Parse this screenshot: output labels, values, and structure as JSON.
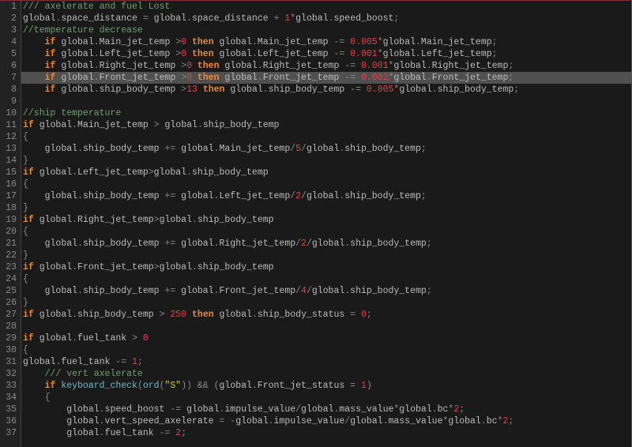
{
  "highlighted_line": 7,
  "lines": [
    {
      "n": 1,
      "tokens": [
        [
          "c",
          "/// axelerate and fuel Lost"
        ]
      ]
    },
    {
      "n": 2,
      "tokens": [
        [
          "v",
          "global"
        ],
        [
          "o",
          "."
        ],
        [
          "v",
          "space_distance"
        ],
        [
          "o",
          " = "
        ],
        [
          "v",
          "global"
        ],
        [
          "o",
          "."
        ],
        [
          "v",
          "space_distance"
        ],
        [
          "o",
          " + "
        ],
        [
          "n",
          "1"
        ],
        [
          "o",
          "*"
        ],
        [
          "v",
          "global"
        ],
        [
          "o",
          "."
        ],
        [
          "v",
          "speed_boost"
        ],
        [
          "o",
          ";"
        ]
      ]
    },
    {
      "n": 3,
      "tokens": [
        [
          "c",
          "//temperature decrease"
        ]
      ]
    },
    {
      "n": 4,
      "tokens": [
        [
          "o",
          "    "
        ],
        [
          "kw",
          "if"
        ],
        [
          "o",
          " "
        ],
        [
          "v",
          "global"
        ],
        [
          "o",
          "."
        ],
        [
          "v",
          "Main_jet_temp"
        ],
        [
          "o",
          " >"
        ],
        [
          "n",
          "0"
        ],
        [
          "o",
          " "
        ],
        [
          "kw",
          "then"
        ],
        [
          "o",
          " "
        ],
        [
          "v",
          "global"
        ],
        [
          "o",
          "."
        ],
        [
          "v",
          "Main_jet_temp"
        ],
        [
          "o",
          " -= "
        ],
        [
          "n",
          "0.005"
        ],
        [
          "o",
          "*"
        ],
        [
          "v",
          "global"
        ],
        [
          "o",
          "."
        ],
        [
          "v",
          "Main_jet_temp"
        ],
        [
          "o",
          ";"
        ]
      ]
    },
    {
      "n": 5,
      "tokens": [
        [
          "o",
          "    "
        ],
        [
          "kw",
          "if"
        ],
        [
          "o",
          " "
        ],
        [
          "v",
          "global"
        ],
        [
          "o",
          "."
        ],
        [
          "v",
          "Left_jet_temp"
        ],
        [
          "o",
          " >"
        ],
        [
          "n",
          "0"
        ],
        [
          "o",
          " "
        ],
        [
          "kw",
          "then"
        ],
        [
          "o",
          " "
        ],
        [
          "v",
          "global"
        ],
        [
          "o",
          "."
        ],
        [
          "v",
          "Left_jet_temp"
        ],
        [
          "o",
          " -= "
        ],
        [
          "n",
          "0.001"
        ],
        [
          "o",
          "*"
        ],
        [
          "v",
          "global"
        ],
        [
          "o",
          "."
        ],
        [
          "v",
          "Left_jet_temp"
        ],
        [
          "o",
          ";"
        ]
      ]
    },
    {
      "n": 6,
      "tokens": [
        [
          "o",
          "    "
        ],
        [
          "kw",
          "if"
        ],
        [
          "o",
          " "
        ],
        [
          "v",
          "global"
        ],
        [
          "o",
          "."
        ],
        [
          "v",
          "Right_jet_temp"
        ],
        [
          "o",
          " >"
        ],
        [
          "n",
          "0"
        ],
        [
          "o",
          " "
        ],
        [
          "kw",
          "then"
        ],
        [
          "o",
          " "
        ],
        [
          "v",
          "global"
        ],
        [
          "o",
          "."
        ],
        [
          "v",
          "Right_jet_temp"
        ],
        [
          "o",
          " -= "
        ],
        [
          "n",
          "0.001"
        ],
        [
          "o",
          "*"
        ],
        [
          "v",
          "global"
        ],
        [
          "o",
          "."
        ],
        [
          "v",
          "Right_jet_temp"
        ],
        [
          "o",
          ";"
        ]
      ]
    },
    {
      "n": 7,
      "tokens": [
        [
          "o",
          "    "
        ],
        [
          "kw",
          "if"
        ],
        [
          "o",
          " "
        ],
        [
          "v",
          "global"
        ],
        [
          "o",
          "."
        ],
        [
          "v",
          "Front_jet_temp"
        ],
        [
          "o",
          " >"
        ],
        [
          "n",
          "0"
        ],
        [
          "o",
          " "
        ],
        [
          "kw",
          "then"
        ],
        [
          "o",
          " "
        ],
        [
          "v",
          "global"
        ],
        [
          "o",
          "."
        ],
        [
          "v",
          "Front_jet_temp"
        ],
        [
          "o",
          " -= "
        ],
        [
          "n",
          "0.002"
        ],
        [
          "o",
          "*"
        ],
        [
          "v",
          "global"
        ],
        [
          "o",
          "."
        ],
        [
          "v",
          "Front_jet_temp"
        ],
        [
          "o",
          ";"
        ]
      ]
    },
    {
      "n": 8,
      "tokens": [
        [
          "o",
          "    "
        ],
        [
          "kw",
          "if"
        ],
        [
          "o",
          " "
        ],
        [
          "v",
          "global"
        ],
        [
          "o",
          "."
        ],
        [
          "v",
          "ship_body_temp"
        ],
        [
          "o",
          " >"
        ],
        [
          "n",
          "13"
        ],
        [
          "o",
          " "
        ],
        [
          "kw",
          "then"
        ],
        [
          "o",
          " "
        ],
        [
          "v",
          "global"
        ],
        [
          "o",
          "."
        ],
        [
          "v",
          "ship_body_temp"
        ],
        [
          "o",
          " -= "
        ],
        [
          "n",
          "0.005"
        ],
        [
          "o",
          "*"
        ],
        [
          "v",
          "global"
        ],
        [
          "o",
          "."
        ],
        [
          "v",
          "ship_body_temp"
        ],
        [
          "o",
          ";"
        ]
      ]
    },
    {
      "n": 9,
      "tokens": []
    },
    {
      "n": 10,
      "tokens": [
        [
          "c",
          "//ship temperature"
        ]
      ]
    },
    {
      "n": 11,
      "tokens": [
        [
          "kw",
          "if"
        ],
        [
          "o",
          " "
        ],
        [
          "v",
          "global"
        ],
        [
          "o",
          "."
        ],
        [
          "v",
          "Main_jet_temp"
        ],
        [
          "o",
          " > "
        ],
        [
          "v",
          "global"
        ],
        [
          "o",
          "."
        ],
        [
          "v",
          "ship_body_temp"
        ]
      ]
    },
    {
      "n": 12,
      "tokens": [
        [
          "b",
          "{"
        ]
      ]
    },
    {
      "n": 13,
      "tokens": [
        [
          "o",
          "    "
        ],
        [
          "v",
          "global"
        ],
        [
          "o",
          "."
        ],
        [
          "v",
          "ship_body_temp"
        ],
        [
          "o",
          " += "
        ],
        [
          "v",
          "global"
        ],
        [
          "o",
          "."
        ],
        [
          "v",
          "Main_jet_temp"
        ],
        [
          "o",
          "/"
        ],
        [
          "n",
          "5"
        ],
        [
          "o",
          "/"
        ],
        [
          "v",
          "global"
        ],
        [
          "o",
          "."
        ],
        [
          "v",
          "ship_body_temp"
        ],
        [
          "o",
          ";"
        ]
      ]
    },
    {
      "n": 14,
      "tokens": [
        [
          "b",
          "}"
        ]
      ]
    },
    {
      "n": 15,
      "tokens": [
        [
          "kw",
          "if"
        ],
        [
          "o",
          " "
        ],
        [
          "v",
          "global"
        ],
        [
          "o",
          "."
        ],
        [
          "v",
          "Left_jet_temp"
        ],
        [
          "o",
          ">"
        ],
        [
          "v",
          "global"
        ],
        [
          "o",
          "."
        ],
        [
          "v",
          "ship_body_temp"
        ]
      ]
    },
    {
      "n": 16,
      "tokens": [
        [
          "b",
          "{"
        ]
      ]
    },
    {
      "n": 17,
      "tokens": [
        [
          "o",
          "    "
        ],
        [
          "v",
          "global"
        ],
        [
          "o",
          "."
        ],
        [
          "v",
          "ship_body_temp"
        ],
        [
          "o",
          " += "
        ],
        [
          "v",
          "global"
        ],
        [
          "o",
          "."
        ],
        [
          "v",
          "Left_jet_temp"
        ],
        [
          "o",
          "/"
        ],
        [
          "n",
          "2"
        ],
        [
          "o",
          "/"
        ],
        [
          "v",
          "global"
        ],
        [
          "o",
          "."
        ],
        [
          "v",
          "ship_body_temp"
        ],
        [
          "o",
          ";"
        ]
      ]
    },
    {
      "n": 18,
      "tokens": [
        [
          "b",
          "}"
        ]
      ]
    },
    {
      "n": 19,
      "tokens": [
        [
          "kw",
          "if"
        ],
        [
          "o",
          " "
        ],
        [
          "v",
          "global"
        ],
        [
          "o",
          "."
        ],
        [
          "v",
          "Right_jet_temp"
        ],
        [
          "o",
          ">"
        ],
        [
          "v",
          "global"
        ],
        [
          "o",
          "."
        ],
        [
          "v",
          "ship_body_temp"
        ]
      ]
    },
    {
      "n": 20,
      "tokens": [
        [
          "b",
          "{"
        ]
      ]
    },
    {
      "n": 21,
      "tokens": [
        [
          "o",
          "    "
        ],
        [
          "v",
          "global"
        ],
        [
          "o",
          "."
        ],
        [
          "v",
          "ship_body_temp"
        ],
        [
          "o",
          " += "
        ],
        [
          "v",
          "global"
        ],
        [
          "o",
          "."
        ],
        [
          "v",
          "Right_jet_temp"
        ],
        [
          "o",
          "/"
        ],
        [
          "n",
          "2"
        ],
        [
          "o",
          "/"
        ],
        [
          "v",
          "global"
        ],
        [
          "o",
          "."
        ],
        [
          "v",
          "ship_body_temp"
        ],
        [
          "o",
          ";"
        ]
      ]
    },
    {
      "n": 22,
      "tokens": [
        [
          "b",
          "}"
        ]
      ]
    },
    {
      "n": 23,
      "tokens": [
        [
          "kw",
          "if"
        ],
        [
          "o",
          " "
        ],
        [
          "v",
          "global"
        ],
        [
          "o",
          "."
        ],
        [
          "v",
          "Front_jet_temp"
        ],
        [
          "o",
          ">"
        ],
        [
          "v",
          "global"
        ],
        [
          "o",
          "."
        ],
        [
          "v",
          "ship_body_temp"
        ]
      ]
    },
    {
      "n": 24,
      "tokens": [
        [
          "b",
          "{"
        ]
      ]
    },
    {
      "n": 25,
      "tokens": [
        [
          "o",
          "    "
        ],
        [
          "v",
          "global"
        ],
        [
          "o",
          "."
        ],
        [
          "v",
          "ship_body_temp"
        ],
        [
          "o",
          " += "
        ],
        [
          "v",
          "global"
        ],
        [
          "o",
          "."
        ],
        [
          "v",
          "Front_jet_temp"
        ],
        [
          "o",
          "/"
        ],
        [
          "n",
          "4"
        ],
        [
          "o",
          "/"
        ],
        [
          "v",
          "global"
        ],
        [
          "o",
          "."
        ],
        [
          "v",
          "ship_body_temp"
        ],
        [
          "o",
          ";"
        ]
      ]
    },
    {
      "n": 26,
      "tokens": [
        [
          "b",
          "}"
        ]
      ]
    },
    {
      "n": 27,
      "tokens": [
        [
          "kw",
          "if"
        ],
        [
          "o",
          " "
        ],
        [
          "v",
          "global"
        ],
        [
          "o",
          "."
        ],
        [
          "v",
          "ship_body_temp"
        ],
        [
          "o",
          " > "
        ],
        [
          "n",
          "250"
        ],
        [
          "o",
          " "
        ],
        [
          "kw",
          "then"
        ],
        [
          "o",
          " "
        ],
        [
          "v",
          "global"
        ],
        [
          "o",
          "."
        ],
        [
          "v",
          "ship_body_status"
        ],
        [
          "o",
          " = "
        ],
        [
          "n",
          "0"
        ],
        [
          "o",
          ";"
        ]
      ]
    },
    {
      "n": 28,
      "tokens": []
    },
    {
      "n": 29,
      "tokens": [
        [
          "kw",
          "if"
        ],
        [
          "o",
          " "
        ],
        [
          "v",
          "global"
        ],
        [
          "o",
          "."
        ],
        [
          "v",
          "fuel_tank"
        ],
        [
          "o",
          " > "
        ],
        [
          "n",
          "0"
        ]
      ]
    },
    {
      "n": 30,
      "tokens": [
        [
          "b",
          "{"
        ]
      ]
    },
    {
      "n": 31,
      "tokens": [
        [
          "v",
          "global"
        ],
        [
          "o",
          "."
        ],
        [
          "v",
          "fuel_tank"
        ],
        [
          "o",
          " -= "
        ],
        [
          "n",
          "1"
        ],
        [
          "o",
          ";"
        ]
      ]
    },
    {
      "n": 32,
      "tokens": [
        [
          "o",
          "    "
        ],
        [
          "c",
          "/// vert axelerate"
        ]
      ]
    },
    {
      "n": 33,
      "tokens": [
        [
          "o",
          "    "
        ],
        [
          "kw",
          "if"
        ],
        [
          "o",
          " "
        ],
        [
          "f",
          "keyboard_check"
        ],
        [
          "o",
          "("
        ],
        [
          "f",
          "ord"
        ],
        [
          "o",
          "("
        ],
        [
          "s",
          "\"S\""
        ],
        [
          "o",
          ")) && ("
        ],
        [
          "v",
          "global"
        ],
        [
          "o",
          "."
        ],
        [
          "v",
          "Front_jet_status"
        ],
        [
          "o",
          " = "
        ],
        [
          "n",
          "1"
        ],
        [
          "o",
          ")"
        ]
      ]
    },
    {
      "n": 34,
      "tokens": [
        [
          "o",
          "    "
        ],
        [
          "b",
          "{"
        ]
      ]
    },
    {
      "n": 35,
      "tokens": [
        [
          "o",
          "        "
        ],
        [
          "v",
          "global"
        ],
        [
          "o",
          "."
        ],
        [
          "v",
          "speed_boost"
        ],
        [
          "o",
          " -= "
        ],
        [
          "v",
          "global"
        ],
        [
          "o",
          "."
        ],
        [
          "v",
          "impulse_value"
        ],
        [
          "o",
          "/"
        ],
        [
          "v",
          "global"
        ],
        [
          "o",
          "."
        ],
        [
          "v",
          "mass_value"
        ],
        [
          "o",
          "*"
        ],
        [
          "v",
          "global"
        ],
        [
          "o",
          "."
        ],
        [
          "v",
          "bc"
        ],
        [
          "o",
          "*"
        ],
        [
          "n",
          "2"
        ],
        [
          "o",
          ";"
        ]
      ]
    },
    {
      "n": 36,
      "tokens": [
        [
          "o",
          "        "
        ],
        [
          "v",
          "global"
        ],
        [
          "o",
          "."
        ],
        [
          "v",
          "vert_speed_axelerate"
        ],
        [
          "o",
          " = -"
        ],
        [
          "v",
          "global"
        ],
        [
          "o",
          "."
        ],
        [
          "v",
          "impulse_value"
        ],
        [
          "o",
          "/"
        ],
        [
          "v",
          "global"
        ],
        [
          "o",
          "."
        ],
        [
          "v",
          "mass_value"
        ],
        [
          "o",
          "*"
        ],
        [
          "v",
          "global"
        ],
        [
          "o",
          "."
        ],
        [
          "v",
          "bc"
        ],
        [
          "o",
          "*"
        ],
        [
          "n",
          "2"
        ],
        [
          "o",
          ";"
        ]
      ]
    },
    {
      "n": 37,
      "tokens": [
        [
          "o",
          "        "
        ],
        [
          "v",
          "global"
        ],
        [
          "o",
          "."
        ],
        [
          "v",
          "fuel_tank"
        ],
        [
          "o",
          " -= "
        ],
        [
          "n",
          "2"
        ],
        [
          "o",
          ";"
        ]
      ]
    }
  ]
}
